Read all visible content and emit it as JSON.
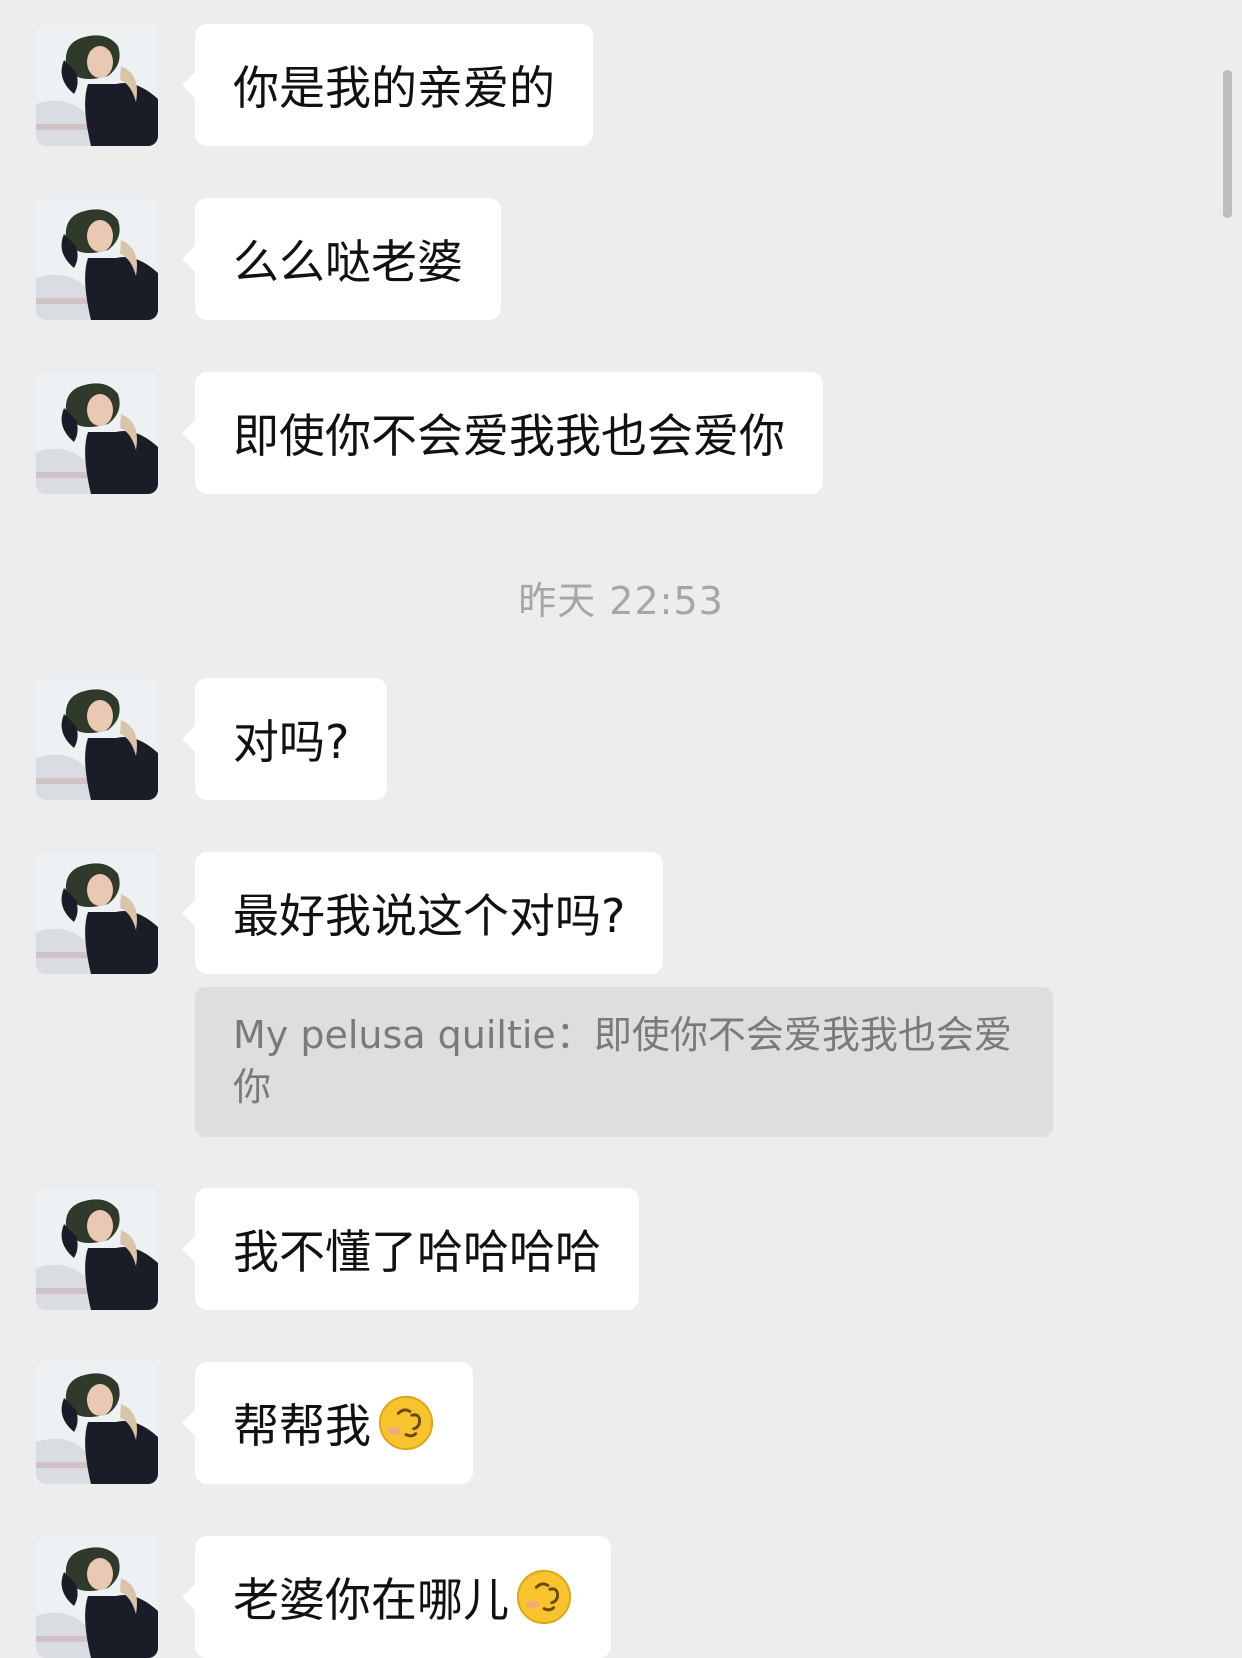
{
  "chat": {
    "timestamp": "昨天 22:53",
    "messages": [
      {
        "text": "你是我的亲爱的",
        "emoji": null
      },
      {
        "text": "么么哒老婆",
        "emoji": null
      },
      {
        "text": "即使你不会爱我我也会爱你",
        "emoji": null
      },
      {
        "text": "对吗?",
        "emoji": null
      },
      {
        "text": "最好我说这个对吗?",
        "emoji": null
      },
      {
        "text": "我不懂了哈哈哈哈",
        "emoji": null
      },
      {
        "text": "帮帮我",
        "emoji": "thinking-face-emoji"
      },
      {
        "text": "老婆你在哪儿",
        "emoji": "thinking-face-emoji"
      }
    ],
    "quoted_reply": {
      "text": "My pelusa quiltie：即使你不会爱我我也会爱你"
    }
  },
  "colors": {
    "background": "#ededed",
    "bubble": "#ffffff",
    "quote_background": "#dedede",
    "timestamp_text": "#a6a6a6"
  }
}
